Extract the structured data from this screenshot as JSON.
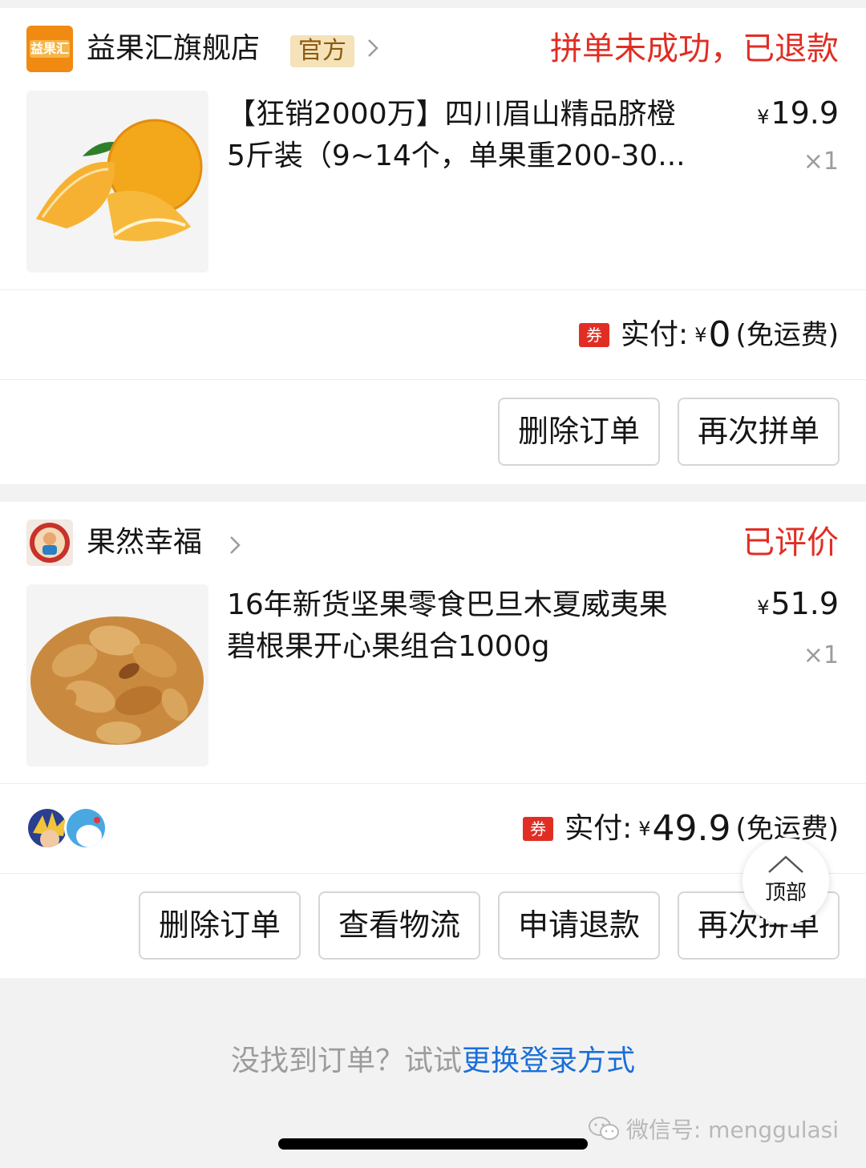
{
  "orders": [
    {
      "shop_logo_text": "益果汇",
      "shop_name": "益果汇旗舰店",
      "official_badge": "官方",
      "status": "拼单未成功，已退款",
      "product_title_line1": "【狂销2000万】四川眉山精品脐橙",
      "product_title_line2": "5斤装（9~14个，单果重200-30...",
      "price_symbol": "¥",
      "price": "19.9",
      "quantity": "×1",
      "coupon": "券",
      "paid_label": "实付:",
      "paid_symbol": "¥",
      "paid_amount": "0",
      "paid_note": "(免运费)",
      "buttons": [
        "删除订单",
        "再次拼单"
      ]
    },
    {
      "shop_name": "果然幸福",
      "status": "已评价",
      "product_title_line1": "16年新货坚果零食巴旦木夏威夷果",
      "product_title_line2": "碧根果开心果组合1000g",
      "price_symbol": "¥",
      "price": "51.9",
      "quantity": "×1",
      "coupon": "券",
      "paid_label": "实付:",
      "paid_symbol": "¥",
      "paid_amount": "49.9",
      "paid_note": "(免运费)",
      "buttons": [
        "删除订单",
        "查看物流",
        "申请退款",
        "再次拼单"
      ]
    }
  ],
  "back_to_top": "顶部",
  "empty_tip": {
    "prefix": "没找到订单？试试",
    "link": "更换登录方式"
  },
  "watermark": "微信号: menggulasi",
  "colors": {
    "status_red": "#e02e24",
    "link_blue": "#1a6fd8",
    "badge_bg": "#f5e2b8"
  }
}
